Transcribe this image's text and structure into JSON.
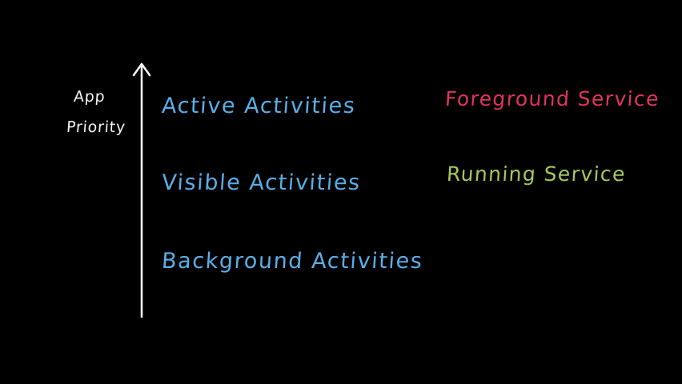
{
  "axis": {
    "label_line1": "App",
    "label_line2": "Priority"
  },
  "activities": [
    {
      "label": "Active Activities"
    },
    {
      "label": "Visible Activities"
    },
    {
      "label": "Background Activities"
    }
  ],
  "services": [
    {
      "label": "Foreground Service",
      "color": "#e0345c"
    },
    {
      "label": "Running Service",
      "color": "#a6c85a"
    }
  ],
  "colors": {
    "background": "#000000",
    "chalk_white": "#f2f2f2",
    "activity_blue": "#5aaee6"
  }
}
